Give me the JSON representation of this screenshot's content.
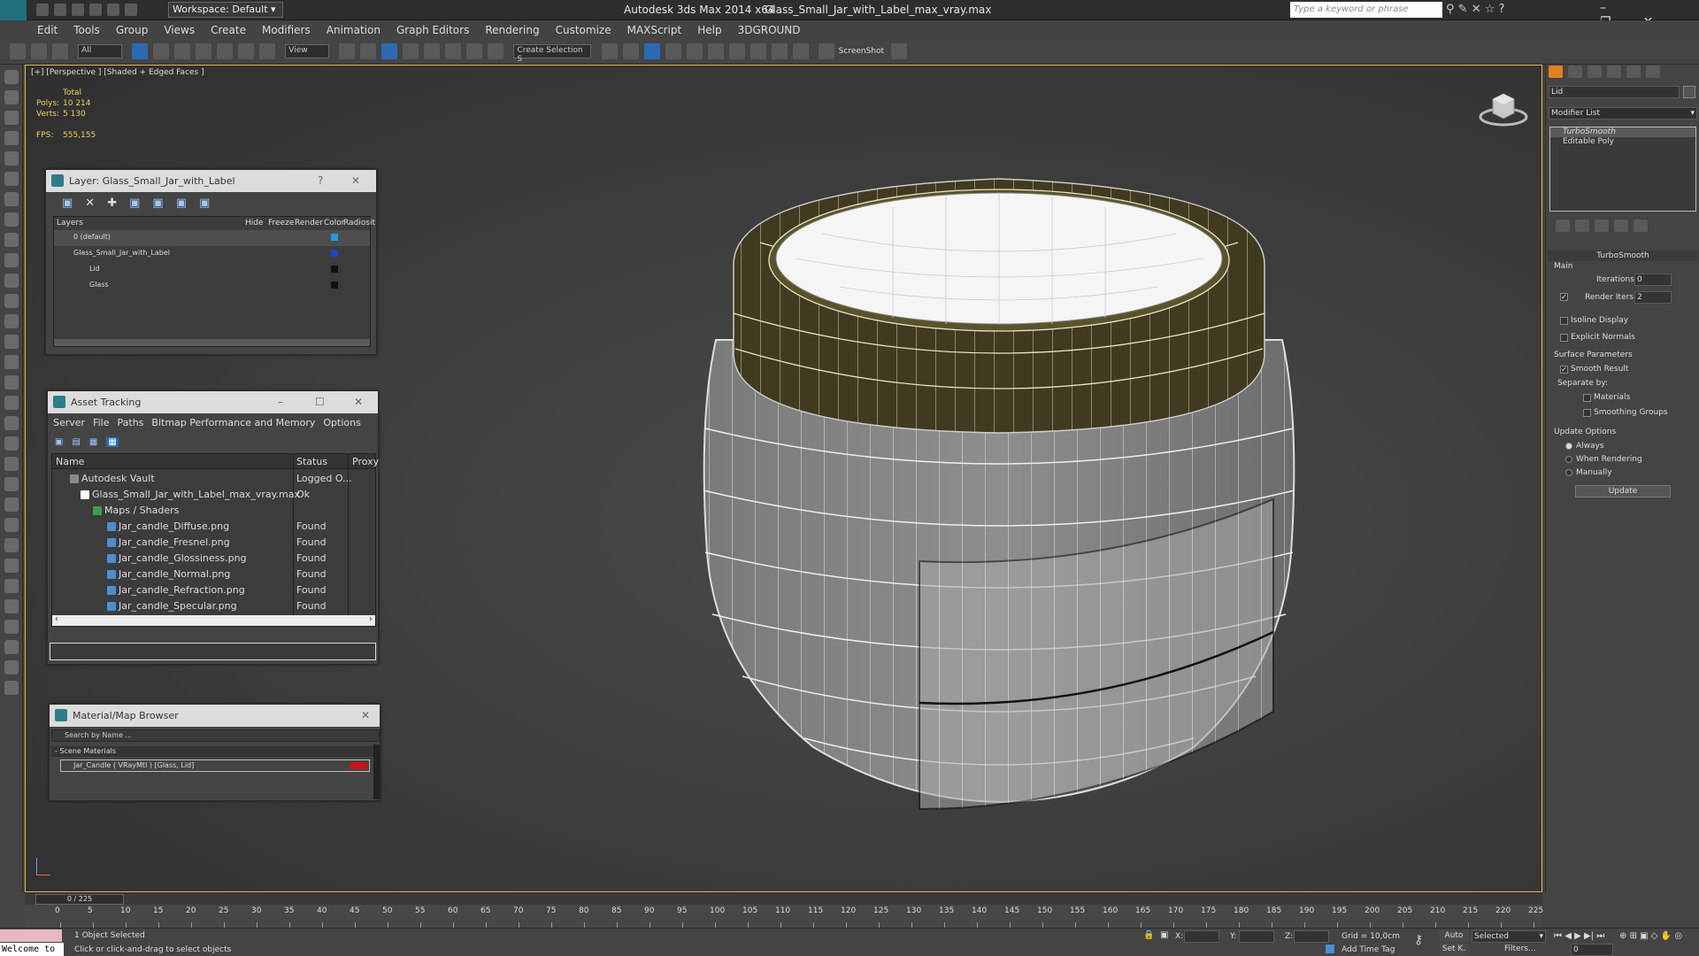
{
  "titlebar": {
    "workspace": "Workspace: Default",
    "app": "Autodesk 3ds Max  2014 x64",
    "file": "Glass_Small_Jar_with_Label_max_vray.max",
    "search_placeholder": "Type a keyword or phrase"
  },
  "menu": [
    "Edit",
    "Tools",
    "Group",
    "Views",
    "Create",
    "Modifiers",
    "Animation",
    "Graph Editors",
    "Rendering",
    "Customize",
    "MAXScript",
    "Help",
    "3DGROUND"
  ],
  "toolbar": {
    "filter": "All",
    "refcoord": "View",
    "selset": "Create Selection S",
    "screenshot": "ScreenShot"
  },
  "viewport": {
    "label": "[+] [Perspective ] [Shaded + Edged Faces ]",
    "stats": {
      "header": "Total",
      "polys_label": "Polys:",
      "polys": "10 214",
      "verts_label": "Verts:",
      "verts": "5 130",
      "fps_label": "FPS:",
      "fps": "555,155"
    }
  },
  "layer": {
    "title": "Layer: Glass_Small_Jar_with_Label",
    "help": "?",
    "columns": [
      "Layers",
      "Hide",
      "Freeze",
      "Render",
      "Color",
      "Radiosit"
    ],
    "rows": [
      {
        "name": "0 (default)"
      },
      {
        "name": "Glass_Small_Jar_with_Label"
      },
      {
        "name": "Lid"
      },
      {
        "name": "Glass"
      }
    ]
  },
  "asset": {
    "title": "Asset Tracking",
    "menu": [
      "Server",
      "File",
      "Paths",
      "Bitmap Performance and Memory",
      "Options"
    ],
    "columns": [
      "Name",
      "Status",
      "Proxy"
    ],
    "rows": [
      {
        "name": "Autodesk Vault",
        "status": "Logged O..."
      },
      {
        "name": "Glass_Small_Jar_with_Label_max_vray.max",
        "status": "Ok"
      },
      {
        "name": "Maps / Shaders",
        "status": ""
      },
      {
        "name": "Jar_candle_Diffuse.png",
        "status": "Found"
      },
      {
        "name": "Jar_candle_Fresnel.png",
        "status": "Found"
      },
      {
        "name": "Jar_candle_Glossiness.png",
        "status": "Found"
      },
      {
        "name": "Jar_candle_Normal.png",
        "status": "Found"
      },
      {
        "name": "Jar_candle_Refraction.png",
        "status": "Found"
      },
      {
        "name": "Jar_candle_Specular.png",
        "status": "Found"
      }
    ]
  },
  "matbrowser": {
    "title": "Material/Map Browser",
    "search_placeholder": "Search by Name ...",
    "section": "- Scene Materials",
    "item": "Jar_Candle ( VRayMtl ) [Glass, Lid]"
  },
  "cmd": {
    "objname": "Lid",
    "modlist": "Modifier List",
    "stack": [
      "TurboSmooth",
      "Editable Poly"
    ],
    "rollout": "TurboSmooth",
    "main": "Main",
    "iterations_label": "Iterations:",
    "iterations": "0",
    "render_iters_label": "Render Iters:",
    "render_iters": "2",
    "isoline": "Isoline Display",
    "explicit": "Explicit Normals",
    "surface": "Surface Parameters",
    "smooth": "Smooth Result",
    "separate": "Separate by:",
    "materials": "Materials",
    "smoothing": "Smoothing Groups",
    "update_opts": "Update Options",
    "always": "Always",
    "when_rendering": "When Rendering",
    "manually": "Manually",
    "update": "Update"
  },
  "timeline": {
    "slider": "0 / 225",
    "ticks": [
      "0",
      "5",
      "10",
      "15",
      "20",
      "25",
      "30",
      "35",
      "40",
      "45",
      "50",
      "55",
      "60",
      "65",
      "70",
      "75",
      "80",
      "85",
      "90",
      "95",
      "100",
      "105",
      "110",
      "115",
      "120",
      "125",
      "130",
      "135",
      "140",
      "145",
      "150",
      "155",
      "160",
      "165",
      "170",
      "175",
      "180",
      "185",
      "190",
      "195",
      "200",
      "205",
      "210",
      "215",
      "220",
      "225"
    ]
  },
  "status": {
    "welcome": "Welcome to",
    "selected": "1 Object Selected",
    "hint": "Click or click-and-drag to select objects",
    "x": "X:",
    "y": "Y:",
    "z": "Z:",
    "grid": "Grid = 10,0cm",
    "addtime": "Add Time Tag",
    "auto": "Auto",
    "setk": "Set K.",
    "key_mode": "Selected",
    "filters": "Filters...",
    "frame": "0"
  }
}
